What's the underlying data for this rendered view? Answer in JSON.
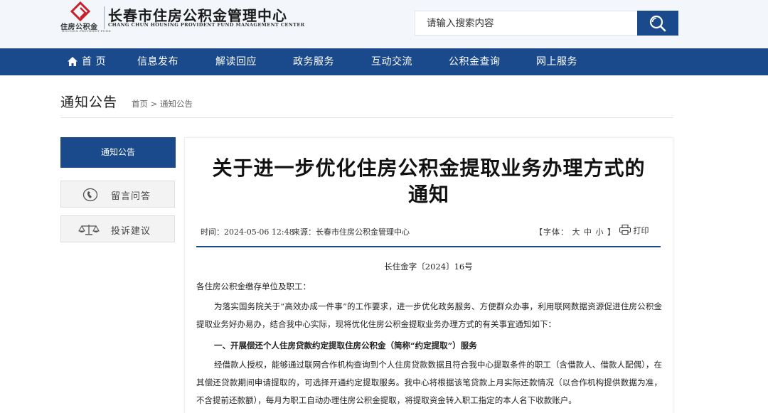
{
  "header": {
    "logo_label": "住房公积金",
    "logo_en": "HOUSING PROVIDENT FUND",
    "title": "长春市住房公积金管理中心",
    "subtitle": "CHANG CHUN HOUSING PROVIDENT FUND MANAGEMENT CENTER",
    "search_placeholder": "请输入搜索内容",
    "brand_red": "#c8202d",
    "brand_blue": "#1b4a8c"
  },
  "nav": {
    "items": [
      {
        "label": "首 页",
        "icon": "home-icon"
      },
      {
        "label": "信息发布"
      },
      {
        "label": "解读回应"
      },
      {
        "label": "政务服务"
      },
      {
        "label": "互动交流"
      },
      {
        "label": "公积金查询"
      },
      {
        "label": "网上服务"
      }
    ]
  },
  "section": {
    "title": "通知公告",
    "breadcrumb": "首页 > 通知公告"
  },
  "sidebar": {
    "active": "通知公告",
    "items": [
      {
        "label": "留言问答",
        "icon": "phone-icon"
      },
      {
        "label": "投诉建议",
        "icon": "scales-icon"
      }
    ]
  },
  "article": {
    "title_line1": "关于进一步优化住房公积金提取业务办理方式的",
    "title_line2": "通知",
    "time": "时间：2024-05-06 12:48",
    "source": "来源：长春市住房公积金管理中心",
    "font_label": "【字体：",
    "font_large": "大",
    "font_medium": "中",
    "font_small": "小",
    "font_close": "】",
    "print_label": "打印",
    "doc_number": "长住金字〔2024〕16号",
    "salutation": "各住房公积金缴存单位及职工：",
    "para1": "为落实国务院关于“高效办成一件事”的工作要求，进一步优化政务服务、方便群众办事，利用联网数据资源促进住房公积金提取业务好办易办，结合我中心实际，现将优化住房公积金提取业务办理方式的有关事宜通知如下：",
    "heading1": "一、开展偿还个人住房贷款约定提取住房公积金（简称“约定提取”）服务",
    "para2": "经借款人授权，能够通过联网合作机构查询到个人住房贷款数据且符合我中心提取条件的职工（含借款人、借款人配偶），在其偿还贷款期间申请提取的，可选择开通约定提取服务。我中心将根据该笔贷款上月实际还款情况（以合作机构提供数据为准，不含提前还款额），每月为职工自动办理住房公积金提取，将提取资金转入职工指定的本人名下收款账户。"
  }
}
